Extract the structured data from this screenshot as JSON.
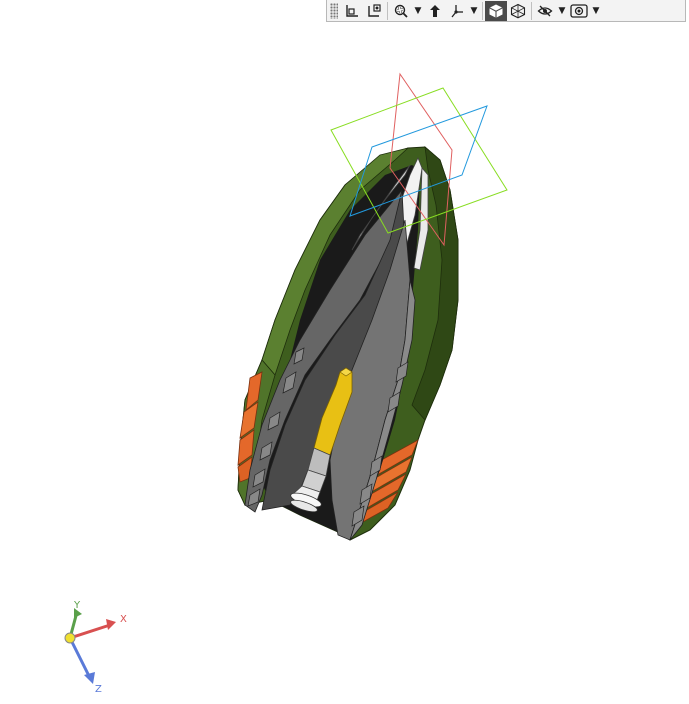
{
  "toolbar": {
    "buttons": [
      {
        "name": "view-orientation-icon",
        "has_dropdown": false,
        "active": false
      },
      {
        "name": "previous-view-icon",
        "has_dropdown": false,
        "active": false
      },
      {
        "name": "zoom-icon",
        "has_dropdown": true,
        "active": false
      },
      {
        "name": "section-view-icon",
        "has_dropdown": false,
        "active": false
      },
      {
        "name": "view-triad-icon",
        "has_dropdown": true,
        "active": false
      },
      {
        "name": "shaded-icon",
        "has_dropdown": false,
        "active": true
      },
      {
        "name": "wireframe-icon",
        "has_dropdown": false,
        "active": false
      },
      {
        "name": "hide-show-icon",
        "has_dropdown": true,
        "active": false
      },
      {
        "name": "display-style-icon",
        "has_dropdown": true,
        "active": false
      }
    ]
  },
  "triad": {
    "x_label": "X",
    "y_label": "Y",
    "z_label": "Z"
  },
  "colors": {
    "section_plane_front": "#e06060",
    "section_plane_top": "#88dd22",
    "section_plane_right": "#2299dd",
    "body_green": "#4a6b25",
    "band_orange": "#e4682a",
    "projectile_yellow": "#e8c014",
    "inner_grey": "#5a5a5a"
  }
}
